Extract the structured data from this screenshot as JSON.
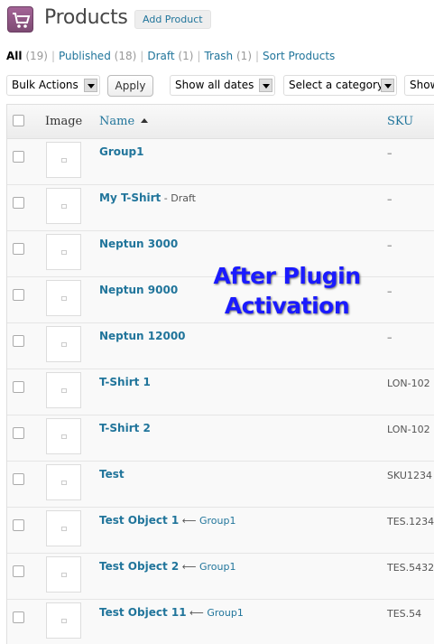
{
  "header": {
    "title": "Products",
    "add_button": "Add Product"
  },
  "filters": [
    {
      "label": "All",
      "count": "(19)",
      "current": true
    },
    {
      "label": "Published",
      "count": "(18)",
      "current": false
    },
    {
      "label": "Draft",
      "count": "(1)",
      "current": false
    },
    {
      "label": "Trash",
      "count": "(1)",
      "current": false
    },
    {
      "label": "Sort Products",
      "count": "",
      "current": false
    }
  ],
  "toolbar": {
    "bulk_actions": "Bulk Actions",
    "apply": "Apply",
    "dates": "Show all dates",
    "category": "Select a category",
    "show": "Show"
  },
  "columns": {
    "image": "Image",
    "name": "Name",
    "sku": "SKU"
  },
  "products": [
    {
      "name": "Group1",
      "state": "",
      "parent": "",
      "sku": "–"
    },
    {
      "name": "My T-Shirt",
      "state": " - Draft",
      "parent": "",
      "sku": "–"
    },
    {
      "name": "Neptun 3000",
      "state": "",
      "parent": "",
      "sku": "–"
    },
    {
      "name": "Neptun 9000",
      "state": "",
      "parent": "",
      "sku": "–"
    },
    {
      "name": "Neptun 12000",
      "state": "",
      "parent": "",
      "sku": "–"
    },
    {
      "name": "T-Shirt 1",
      "state": "",
      "parent": "",
      "sku": "LON-102"
    },
    {
      "name": "T-Shirt 2",
      "state": "",
      "parent": "",
      "sku": "LON-102"
    },
    {
      "name": "Test",
      "state": "",
      "parent": "",
      "sku": "SKU1234"
    },
    {
      "name": "Test Object 1",
      "state": "",
      "parent": "Group1",
      "sku": "TES.1234"
    },
    {
      "name": "Test Object 2",
      "state": "",
      "parent": "Group1",
      "sku": "TES.5432"
    },
    {
      "name": "Test Object 11",
      "state": "",
      "parent": "Group1",
      "sku": "TES.54"
    }
  ],
  "overlay": {
    "line1": "After Plugin",
    "line2": "Activation"
  }
}
